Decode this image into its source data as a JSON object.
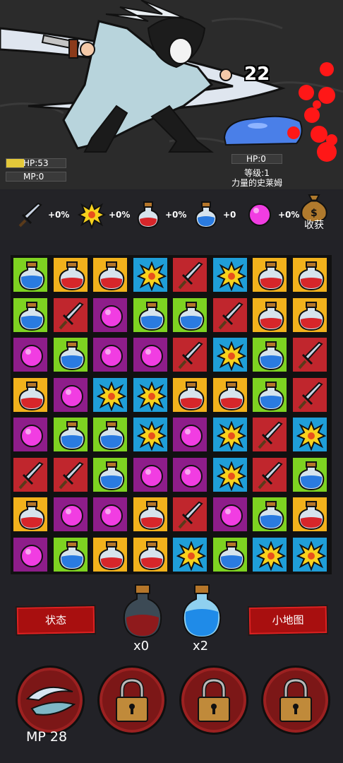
{
  "player": {
    "hp_label": "HP:53",
    "mp_label": "MP:0",
    "hp_fraction": 0.3
  },
  "enemy": {
    "hp_label": "HP:0",
    "level_label": "等级:1",
    "name": "力量的史莱姆"
  },
  "damage_number": "22",
  "buffs": [
    {
      "icon": "sword-icon",
      "value": "+0%"
    },
    {
      "icon": "explosion-icon",
      "value": "+0%"
    },
    {
      "icon": "red-potion-icon",
      "value": "+0%"
    },
    {
      "icon": "blue-potion-icon",
      "value": "+0"
    },
    {
      "icon": "pink-orb-icon",
      "value": "+0%"
    }
  ],
  "harvest_label": "收获",
  "board": [
    [
      "blue",
      "red",
      "red",
      "burst",
      "sword",
      "burst",
      "red",
      "red"
    ],
    [
      "blue",
      "sword",
      "orb",
      "blue",
      "blue",
      "sword",
      "red",
      "red"
    ],
    [
      "orb",
      "blue",
      "orb",
      "orb",
      "sword",
      "burst",
      "blue",
      "sword"
    ],
    [
      "red",
      "orb",
      "burst",
      "burst",
      "red",
      "red",
      "blue",
      "sword"
    ],
    [
      "orb",
      "blue",
      "blue",
      "burst",
      "orb",
      "burst",
      "sword",
      "burst"
    ],
    [
      "sword",
      "sword",
      "blue",
      "orb",
      "orb",
      "burst",
      "sword",
      "blue"
    ],
    [
      "red",
      "orb",
      "orb",
      "red",
      "sword",
      "orb",
      "blue",
      "red"
    ],
    [
      "orb",
      "blue",
      "red",
      "red",
      "burst",
      "blue",
      "burst",
      "burst"
    ]
  ],
  "tile_colors": {
    "blue": "#7ed321",
    "red": "#f2b21c",
    "sword": "#c0262d",
    "burst": "#1f9ed8",
    "orb": "#8e1d8a"
  },
  "status_button": "状态",
  "minimap_button": "小地图",
  "red_potion_count": "x0",
  "blue_potion_count": "x2",
  "mp_text": "MP 28",
  "skills": [
    {
      "icon": "wind-slash-icon",
      "locked": false
    },
    {
      "icon": "lock-icon",
      "locked": true
    },
    {
      "icon": "lock-icon",
      "locked": true
    },
    {
      "icon": "lock-icon",
      "locked": true
    }
  ]
}
